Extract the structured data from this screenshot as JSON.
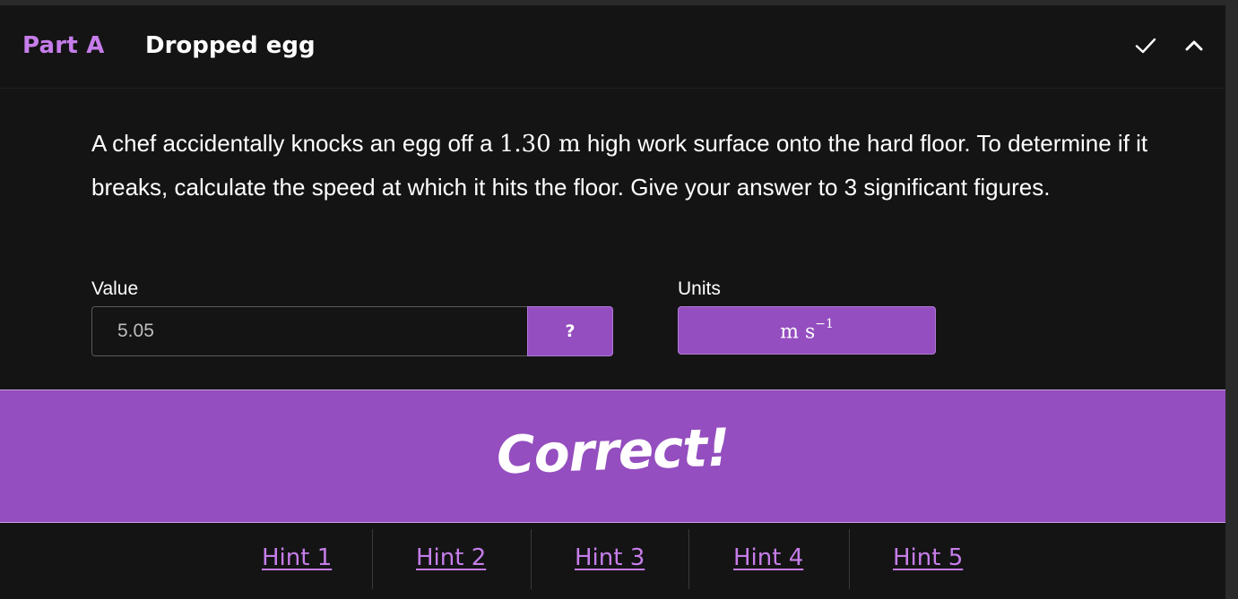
{
  "header": {
    "part_label": "Part A",
    "title": "Dropped egg",
    "check_icon": "checkmark-icon",
    "collapse_icon": "chevron-up-icon"
  },
  "question": {
    "text_before": "A chef accidentally knocks an egg off a ",
    "height_value": "1.30",
    "height_unit": "m",
    "text_after": " high work surface onto the hard floor. To determine if it breaks, calculate the speed at which it hits the floor. Give your answer to 3 significant figures."
  },
  "answer": {
    "value_label": "Value",
    "value": "5.05",
    "help_label": "?",
    "units_label": "Units",
    "units_base": "m s",
    "units_exponent": "−1"
  },
  "feedback": {
    "message": "Correct!"
  },
  "hints": [
    {
      "label": "Hint 1"
    },
    {
      "label": "Hint 2"
    },
    {
      "label": "Hint 3"
    },
    {
      "label": "Hint 4"
    },
    {
      "label": "Hint 5"
    }
  ],
  "colors": {
    "accent": "#944ebf",
    "accent_text": "#c67dea",
    "background": "#141414"
  }
}
